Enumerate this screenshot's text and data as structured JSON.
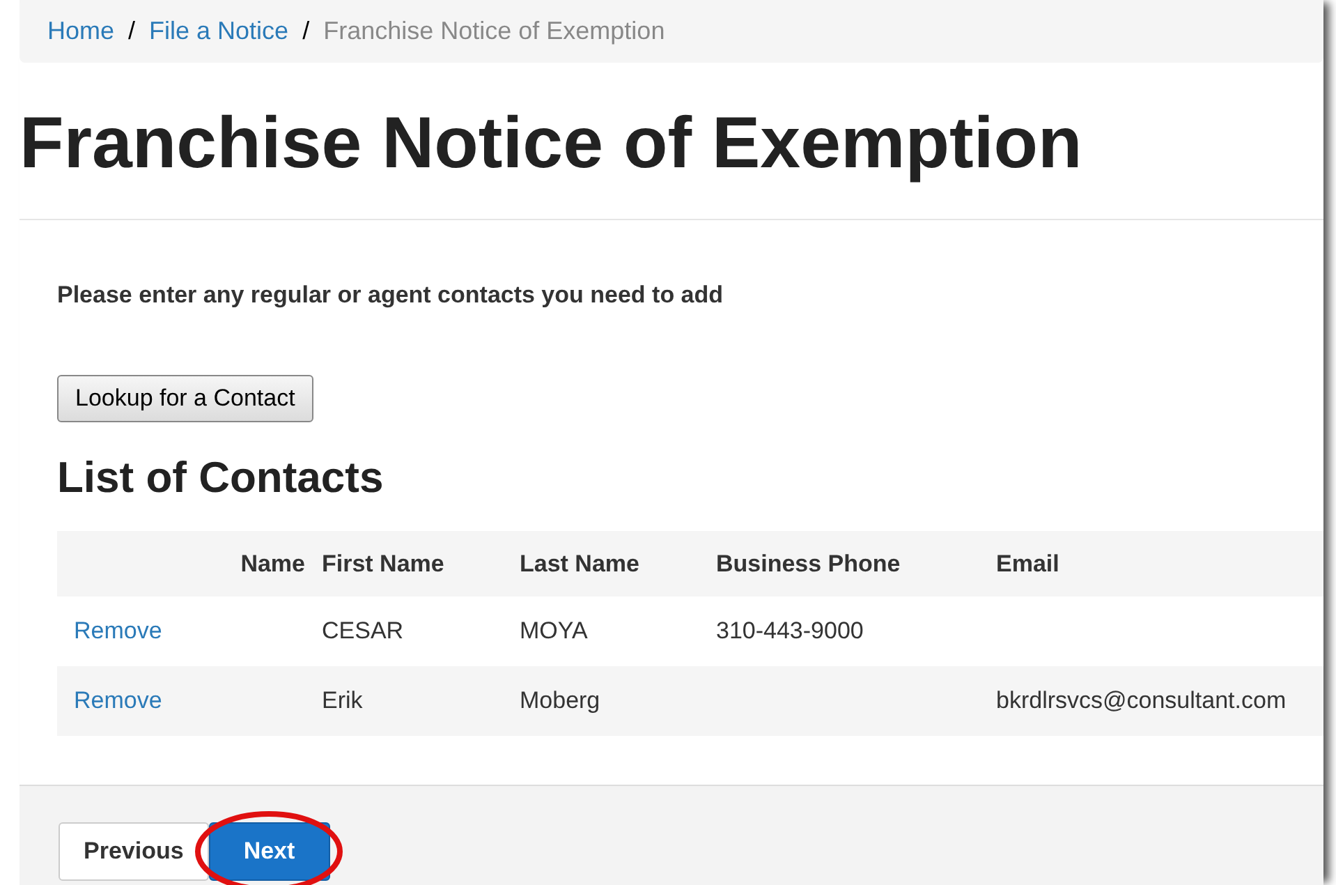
{
  "breadcrumb_separator": "/",
  "breadcrumb": [
    {
      "label": "Home",
      "kind": "link"
    },
    {
      "label": "File a Notice",
      "kind": "link"
    },
    {
      "label": "Franchise Notice of Exemption",
      "kind": "current"
    }
  ],
  "title": "Franchise Notice of Exemption",
  "instructions": "Please enter any regular or agent contacts you need to add",
  "lookup_button": "Lookup for a Contact",
  "contacts": {
    "heading": "List of Contacts",
    "columns": [
      "",
      "Name",
      "First Name",
      "Last Name",
      "Business Phone",
      "Email"
    ],
    "rows": [
      {
        "action": "Remove",
        "first_name": "CESAR",
        "last_name": "MOYA",
        "business_phone": "310-443-9000"
      },
      {
        "action": "Remove",
        "first_name": "Erik",
        "last_name": "Moberg",
        "email": "bkrdlrsvcs@consultant.com"
      }
    ]
  },
  "footer_buttons": [
    {
      "label": "Previous",
      "kind": "default",
      "highlighted": false
    },
    {
      "label": "Next",
      "kind": "primary",
      "highlighted": true
    }
  ]
}
